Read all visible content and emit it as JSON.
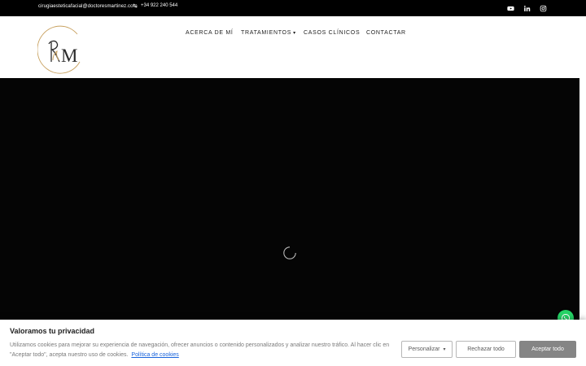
{
  "topbar": {
    "email": "cirugiaesteticafacial@doctoresmartinez.com",
    "phone": "+34 922 240 544",
    "social": [
      "youtube-icon",
      "linkedin-icon",
      "instagram-icon"
    ]
  },
  "logo": {
    "letters_main": "M",
    "letters_script": "R"
  },
  "nav": {
    "items": [
      {
        "label": "ACERCA DE MÍ"
      },
      {
        "label": "TRATAMIENTOS",
        "has_dropdown": true
      },
      {
        "label": "CASOS CLÍNICOS"
      },
      {
        "label": "CONTACTAR"
      }
    ]
  },
  "hero": {
    "state": "loading"
  },
  "whatsapp": {
    "icon": "whatsapp-icon"
  },
  "cookie_banner": {
    "title": "Valoramos tu privacidad",
    "text": "Utilizamos cookies para mejorar su experiencia de navegación, ofrecer anuncios o contenido personalizados y analizar nuestro tráfico. Al hacer clic en \"Aceptar todo\", acepta nuestro uso de cookies.",
    "policy_link": "Política de cookies",
    "customize_label": "Personalizar",
    "reject_label": "Rechazar todo",
    "accept_label": "Aceptar todo"
  },
  "colors": {
    "topbar_bg": "#000000",
    "hero_bg": "#050505",
    "logo_gold": "#c8a15f",
    "link_blue": "#1863dc",
    "accept_bg": "#858585",
    "whatsapp_green": "#25d366"
  }
}
